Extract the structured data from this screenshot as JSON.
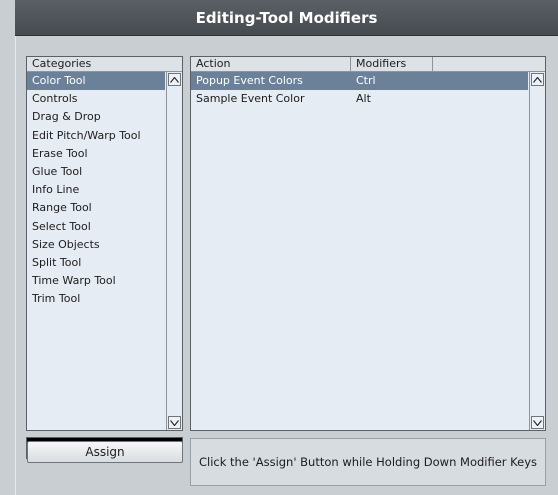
{
  "window": {
    "title": "Editing-Tool Modifiers"
  },
  "categories": {
    "header": "Categories",
    "items": [
      "Color Tool",
      "Controls",
      "Drag & Drop",
      "Edit Pitch/Warp Tool",
      "Erase Tool",
      "Glue Tool",
      "Info Line",
      "Range Tool",
      "Select Tool",
      "Size Objects",
      "Split Tool",
      "Time Warp Tool",
      "Trim Tool"
    ],
    "selected_index": 0
  },
  "actions": {
    "headers": [
      "Action",
      "Modifiers"
    ],
    "rows": [
      {
        "action": "Popup Event Colors",
        "modifiers": "Ctrl"
      },
      {
        "action": "Sample Event Color",
        "modifiers": "Alt"
      }
    ],
    "selected_index": 0
  },
  "assign": {
    "label": "Assign"
  },
  "info": {
    "text": "Click the 'Assign' Button while Holding Down Modifier Keys"
  },
  "colors": {
    "title_bg": "#4f5459",
    "list_bg": "#e6ecf3",
    "selection": "#6b8199",
    "panel_bg": "#c9ced3",
    "modifier_display": "#000000"
  },
  "icons": {
    "scroll_up": "triangle-up-icon",
    "scroll_down": "triangle-down-icon"
  }
}
